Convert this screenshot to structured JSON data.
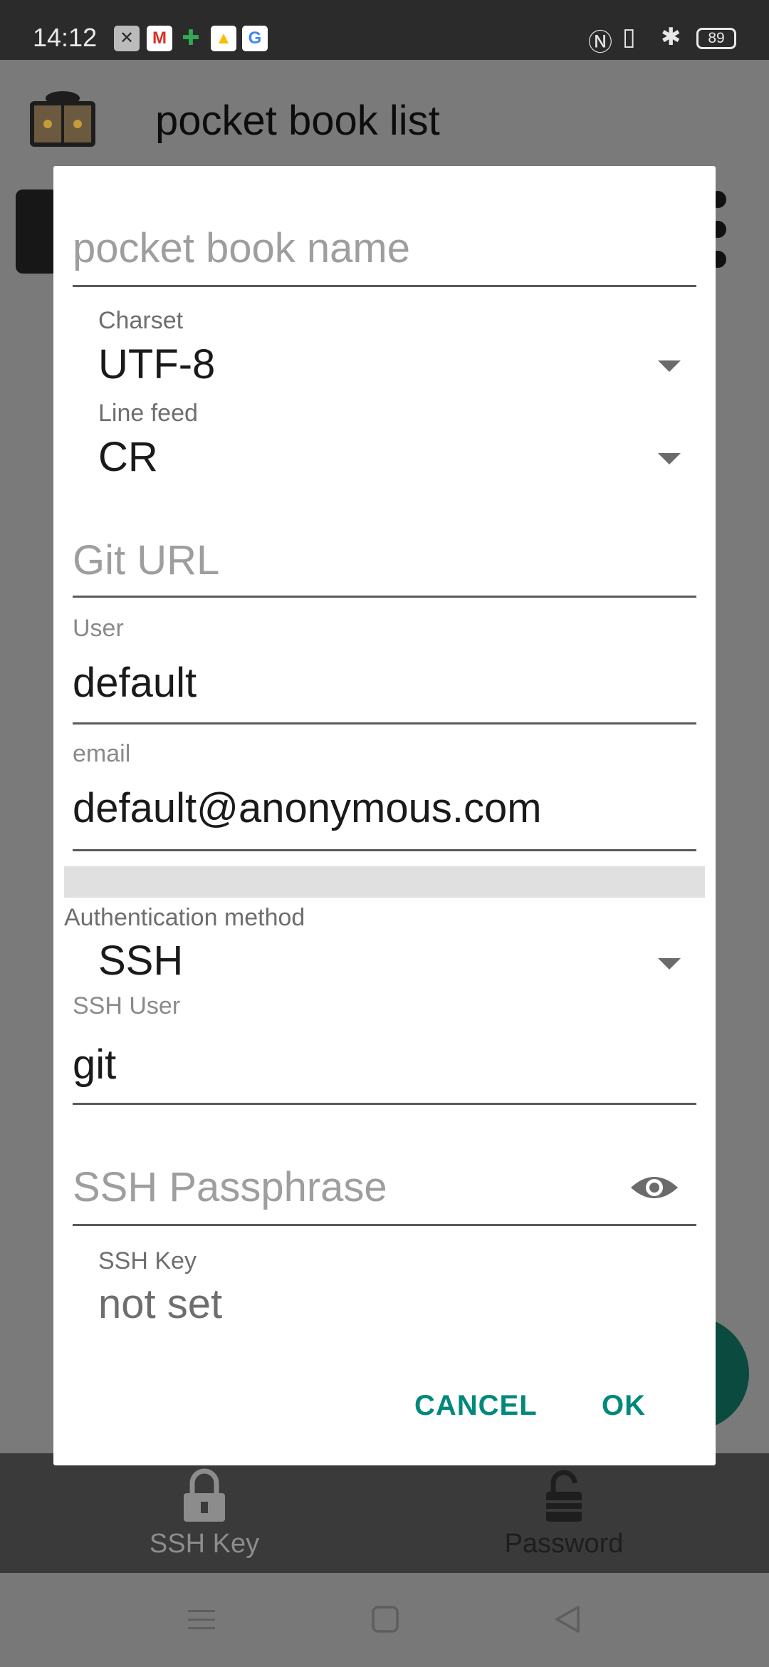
{
  "status_bar": {
    "time": "14:12",
    "battery": "89",
    "notification_icons": [
      "close-notification-icon",
      "gmail-icon",
      "puzzle-icon",
      "drive-icon",
      "google-icon"
    ],
    "right_icons": [
      "nfc-icon",
      "vibrate-icon",
      "bluetooth-icon",
      "battery-icon"
    ]
  },
  "app": {
    "title": "pocket book list"
  },
  "dialog": {
    "name_placeholder": "pocket book name",
    "charset": {
      "label": "Charset",
      "value": "UTF-8"
    },
    "line_feed": {
      "label": "Line feed",
      "value": "CR"
    },
    "git_url_placeholder": "Git URL",
    "user": {
      "label": "User",
      "value": "default"
    },
    "email": {
      "label": "email",
      "value": "default@anonymous.com"
    },
    "auth": {
      "label": "Authentication method",
      "value": "SSH"
    },
    "ssh_user": {
      "label": "SSH User",
      "value": "git"
    },
    "ssh_passphrase_placeholder": "SSH Passphrase",
    "ssh_key": {
      "label": "SSH Key",
      "value": "not set"
    },
    "cancel_label": "CANCEL",
    "ok_label": "OK"
  },
  "bottom_nav": {
    "ssh_key_label": "SSH Key",
    "password_label": "Password"
  },
  "colors": {
    "accent": "#00897b",
    "scrim": "#7a7a7a",
    "fab": "#0a4a3f"
  }
}
